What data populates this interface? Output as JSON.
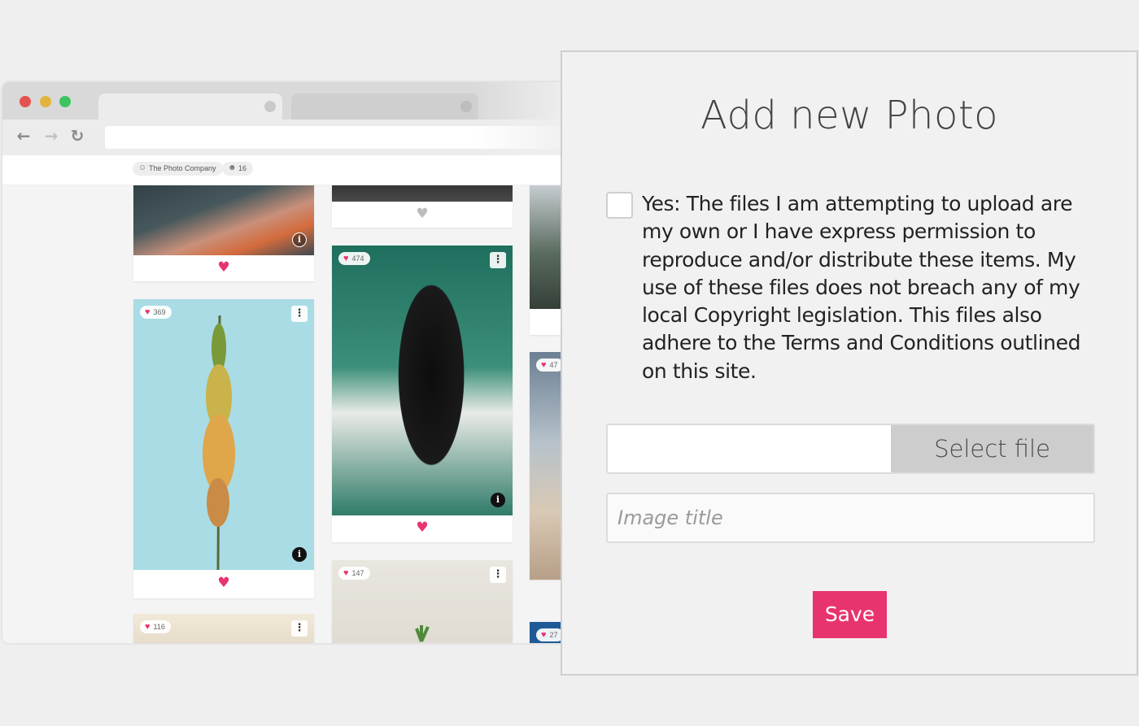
{
  "browser": {
    "header": {
      "company_chip": "The Photo Company",
      "members_chip": "16"
    },
    "cards": [
      {
        "id": "c1",
        "likes": ""
      },
      {
        "id": "c2",
        "likes": "369"
      },
      {
        "id": "c3",
        "likes": "116"
      },
      {
        "id": "c4",
        "likes": ""
      },
      {
        "id": "c5",
        "likes": "474"
      },
      {
        "id": "c6",
        "likes": "147"
      },
      {
        "id": "c7",
        "likes": "47"
      },
      {
        "id": "c8",
        "likes": "27"
      }
    ],
    "icons": {
      "heart": "♥",
      "menu": "⋮",
      "info": "i",
      "back": "←",
      "forward": "→",
      "reload": "↻"
    }
  },
  "dialog": {
    "title": "Add new Photo",
    "consent_text": "Yes: The files I am attempting to upload are\nmy own or I have express permission to\nreproduce and/or distribute these items. My\nuse of these files does not breach any of my\nlocal Copyright legislation. This files also\nadhere to the Terms and Conditions outlined\non this site.",
    "consent_checked": false,
    "file_path": "",
    "select_file_label": "Select file",
    "image_title_placeholder": "Image title",
    "image_title_value": "",
    "save_label": "Save"
  },
  "colors": {
    "accent": "#e8346e",
    "page_background": "#efefef",
    "dialog_background": "#f1f1f1",
    "select_file_button": "#cdcdcd"
  }
}
